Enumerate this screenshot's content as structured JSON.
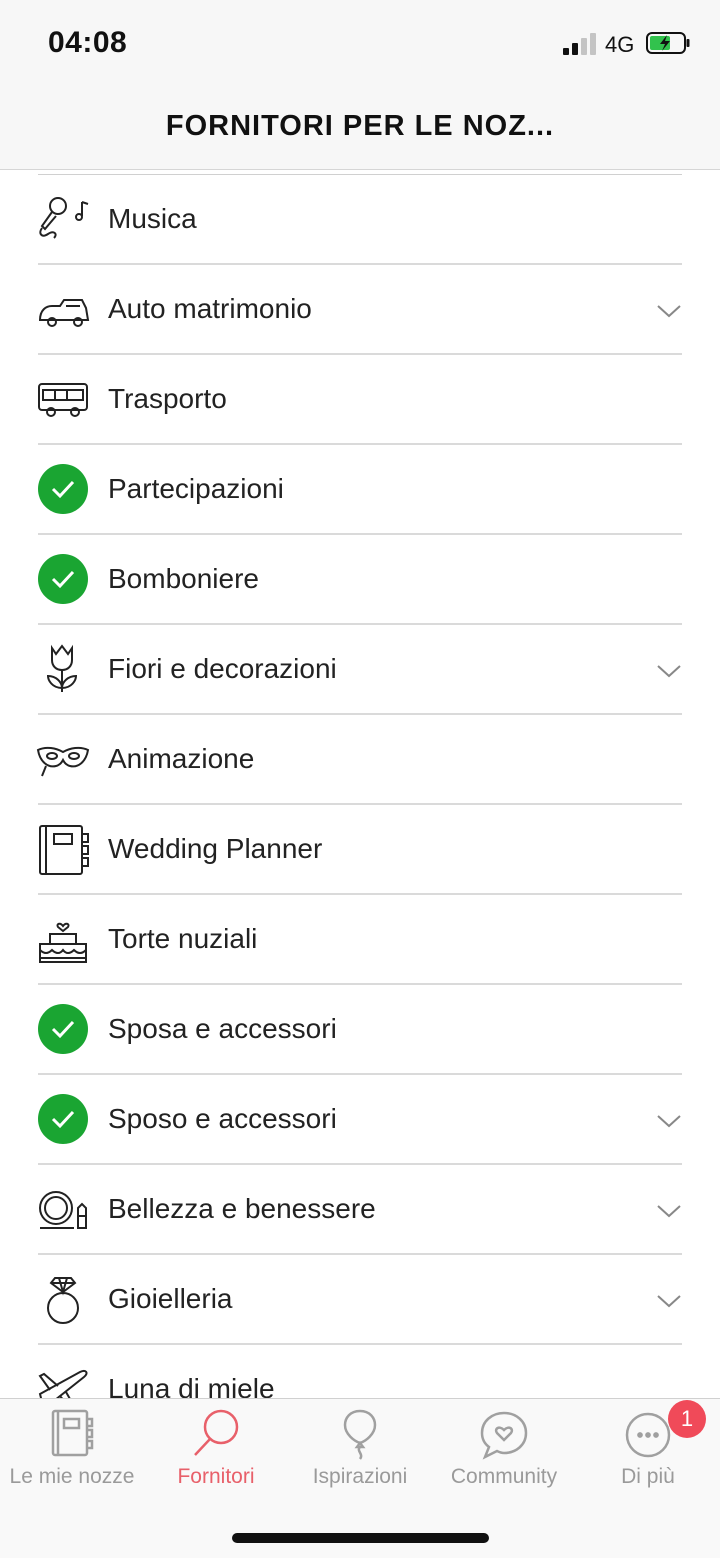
{
  "status": {
    "time": "04:08",
    "network": "4G"
  },
  "header": {
    "title": "FORNITORI PER LE NOZ..."
  },
  "categories": [
    {
      "label": "Musica",
      "icon": "microphone-music-icon",
      "checked": false,
      "expandable": false
    },
    {
      "label": "Auto matrimonio",
      "icon": "wedding-car-icon",
      "checked": false,
      "expandable": true
    },
    {
      "label": "Trasporto",
      "icon": "bus-icon",
      "checked": false,
      "expandable": false
    },
    {
      "label": "Partecipazioni",
      "icon": "checkmark-icon",
      "checked": true,
      "expandable": false
    },
    {
      "label": "Bomboniere",
      "icon": "checkmark-icon",
      "checked": true,
      "expandable": false
    },
    {
      "label": "Fiori e decorazioni",
      "icon": "tulip-icon",
      "checked": false,
      "expandable": true
    },
    {
      "label": "Animazione",
      "icon": "mask-icon",
      "checked": false,
      "expandable": false
    },
    {
      "label": "Wedding Planner",
      "icon": "planner-book-icon",
      "checked": false,
      "expandable": false
    },
    {
      "label": "Torte nuziali",
      "icon": "wedding-cake-icon",
      "checked": false,
      "expandable": false
    },
    {
      "label": "Sposa e accessori",
      "icon": "checkmark-icon",
      "checked": true,
      "expandable": false
    },
    {
      "label": "Sposo e accessori",
      "icon": "checkmark-icon",
      "checked": true,
      "expandable": true
    },
    {
      "label": "Bellezza e benessere",
      "icon": "beauty-icon",
      "checked": false,
      "expandable": true
    },
    {
      "label": "Gioielleria",
      "icon": "ring-icon",
      "checked": false,
      "expandable": true
    },
    {
      "label": "Luna di miele",
      "icon": "airplane-icon",
      "checked": false,
      "expandable": false
    }
  ],
  "tabs": [
    {
      "label": "Le mie nozze",
      "icon": "notebook-icon",
      "active": false
    },
    {
      "label": "Fornitori",
      "icon": "search-icon",
      "active": true
    },
    {
      "label": "Ispirazioni",
      "icon": "balloon-icon",
      "active": false
    },
    {
      "label": "Community",
      "icon": "chat-heart-icon",
      "active": false
    },
    {
      "label": "Di più",
      "icon": "more-icon",
      "active": false
    }
  ],
  "badge": {
    "count": "1"
  },
  "colors": {
    "check_green": "#1aa532",
    "accent": "#e8606a",
    "badge": "#f04a59"
  }
}
